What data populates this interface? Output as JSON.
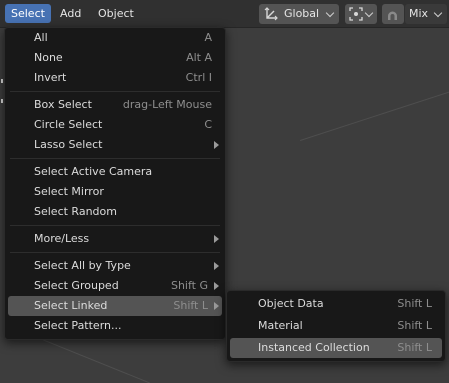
{
  "header": {
    "menus": [
      "Select",
      "Add",
      "Object"
    ],
    "orientation": "Global",
    "mix_label": "Mix"
  },
  "select_menu": {
    "groups": [
      [
        {
          "label": "All",
          "shortcut": "A",
          "submenu": false
        },
        {
          "label": "None",
          "shortcut": "Alt A",
          "submenu": false
        },
        {
          "label": "Invert",
          "shortcut": "Ctrl I",
          "submenu": false
        }
      ],
      [
        {
          "label": "Box Select",
          "shortcut": "drag-Left Mouse",
          "submenu": false
        },
        {
          "label": "Circle Select",
          "shortcut": "C",
          "submenu": false
        },
        {
          "label": "Lasso Select",
          "shortcut": "",
          "submenu": true
        }
      ],
      [
        {
          "label": "Select Active Camera",
          "shortcut": "",
          "submenu": false
        },
        {
          "label": "Select Mirror",
          "shortcut": "",
          "submenu": false
        },
        {
          "label": "Select Random",
          "shortcut": "",
          "submenu": false
        }
      ],
      [
        {
          "label": "More/Less",
          "shortcut": "",
          "submenu": true
        }
      ],
      [
        {
          "label": "Select All by Type",
          "shortcut": "",
          "submenu": true
        },
        {
          "label": "Select Grouped",
          "shortcut": "Shift G",
          "submenu": true
        },
        {
          "label": "Select Linked",
          "shortcut": "Shift L",
          "submenu": true,
          "active": true
        },
        {
          "label": "Select Pattern...",
          "shortcut": "",
          "submenu": false
        }
      ]
    ]
  },
  "linked_submenu": {
    "items": [
      {
        "label": "Object Data",
        "shortcut": "Shift L"
      },
      {
        "label": "Material",
        "shortcut": "Shift L"
      },
      {
        "label": "Instanced Collection",
        "shortcut": "Shift L",
        "active": true
      }
    ]
  },
  "colors": {
    "accent": "#4772b3",
    "menu_bg": "#181818",
    "header_bg": "#303030",
    "viewport_bg": "#3d3d3d"
  }
}
